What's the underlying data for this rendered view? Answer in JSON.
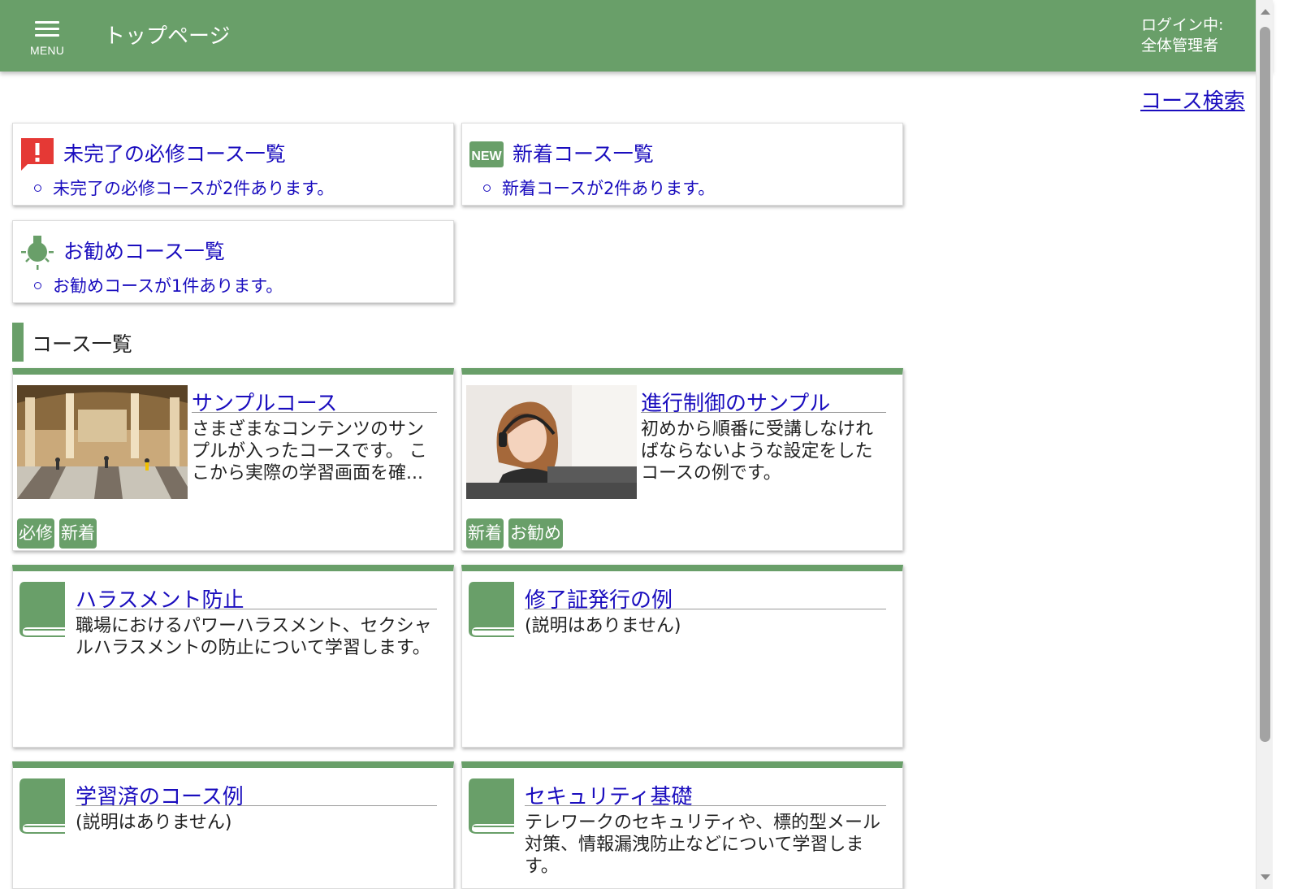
{
  "header": {
    "menu_label": "MENU",
    "title": "トップページ",
    "login_line1": "ログイン中:",
    "login_line2": "全体管理者"
  },
  "search_link": "コース検索",
  "summaries": [
    {
      "title": "未完了の必修コース一覧",
      "item": "未完了の必修コースが2件あります。",
      "icon": "alert-icon",
      "color": "#e53935"
    },
    {
      "title": "新着コース一覧",
      "item": "新着コースが2件あります。",
      "icon": "new-badge-icon",
      "color": "#699f69"
    },
    {
      "title": "お勧めコース一覧",
      "item": "お勧めコースが1件あります。",
      "icon": "lightbulb-icon",
      "color": "#699f69"
    }
  ],
  "section_title": "コース一覧",
  "courses": [
    {
      "title": "サンプルコース",
      "desc": "さまざまなコンテンツのサンプルが入ったコースです。 ここから実際の学習画面を確...",
      "tags": [
        "必修",
        "新着"
      ],
      "thumb": "station-photo"
    },
    {
      "title": "進行制御のサンプル",
      "desc": "初めから順番に受講しなければならないような設定をしたコースの例です。",
      "tags": [
        "新着",
        "お勧め"
      ],
      "thumb": "headset-operator-photo"
    },
    {
      "title": "ハラスメント防止",
      "desc": "職場におけるパワーハラスメント、セクシャルハラスメントの防止について学習します。",
      "tags": [],
      "thumb": "book-icon"
    },
    {
      "title": "修了証発行の例",
      "desc": "(説明はありません)",
      "tags": [],
      "thumb": "book-icon"
    },
    {
      "title": "学習済のコース例",
      "desc": "(説明はありません)",
      "tags": [],
      "thumb": "book-icon"
    },
    {
      "title": "セキュリティ基礎",
      "desc": "テレワークのセキュリティや、標的型メール対策、情報漏洩防止などについて学習します。",
      "tags": [],
      "thumb": "book-icon"
    }
  ],
  "theme": {
    "accent": "#699f69",
    "link": "#1a0dbe",
    "alert": "#e53935"
  }
}
